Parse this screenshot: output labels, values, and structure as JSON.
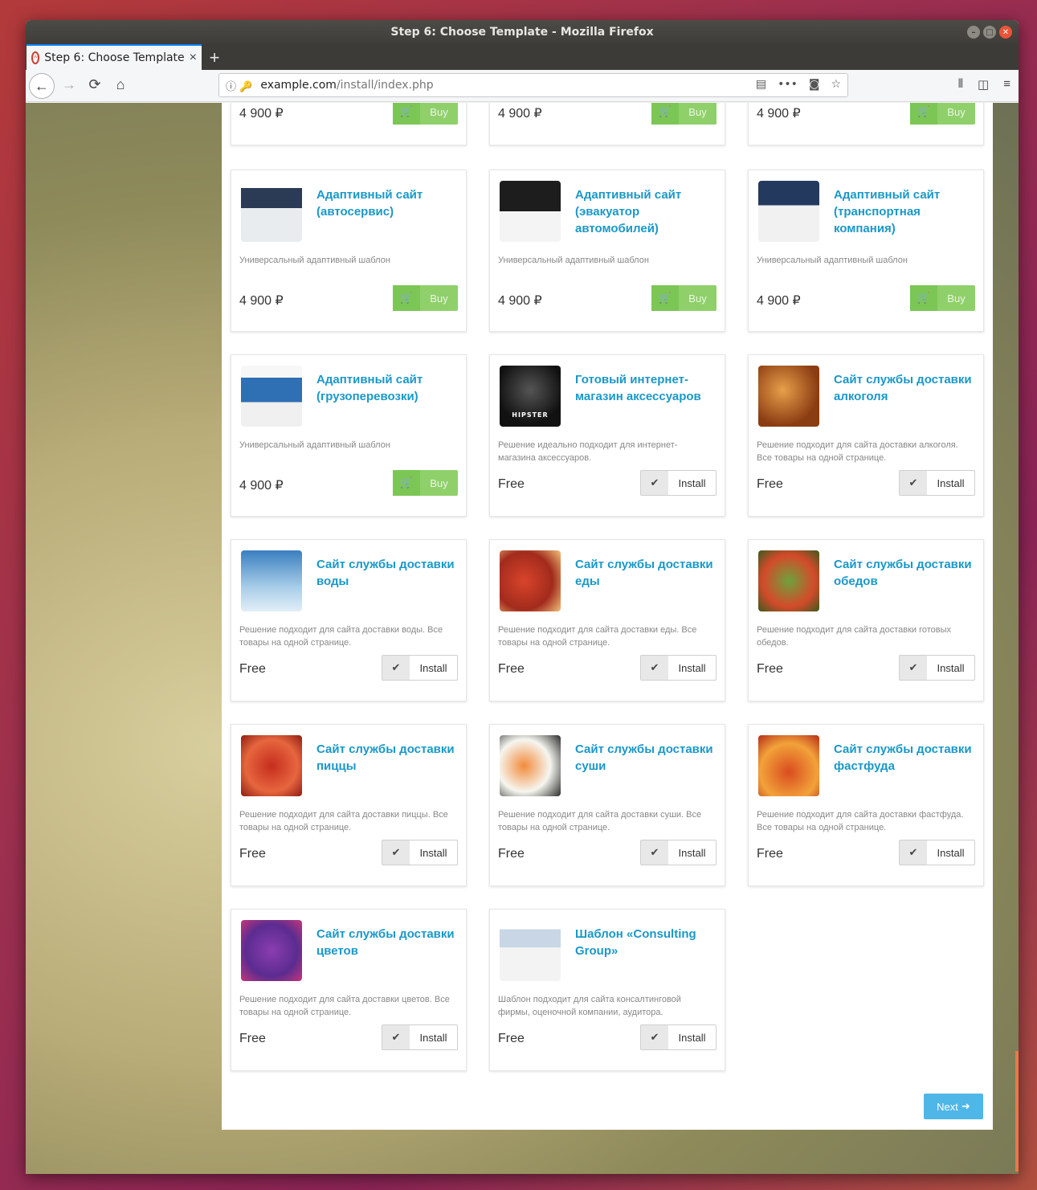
{
  "window": {
    "title": "Step 6: Choose Template - Mozilla Firefox"
  },
  "tab": {
    "title": "Step 6: Choose Template",
    "close": "×",
    "new_tab": "+"
  },
  "url": {
    "domain": "example.com",
    "path": "/install/index.php"
  },
  "icons": {
    "back": "←",
    "forward": "→",
    "reload": "⟳",
    "home": "⌂",
    "menu": "≡",
    "more": "•••",
    "cart": "🛒",
    "check": "✔",
    "next_arrow": "➜"
  },
  "colors": {
    "title_blue": "#1a98c8",
    "buy_green": "#8fd06b",
    "next_blue": "#4fb6e8"
  },
  "top_row": [
    {
      "price": "4 900 ₽",
      "button": "Buy"
    },
    {
      "price": "4 900 ₽",
      "button": "Buy"
    },
    {
      "price": "4 900 ₽",
      "button": "Buy"
    }
  ],
  "cards": [
    {
      "title": "Адаптивный сайт (автосервис)",
      "desc": "Универсальный адаптивный шаблон",
      "price": "4 900 ₽",
      "button": "Buy",
      "thumb": "autoservice"
    },
    {
      "title": "Адаптивный сайт (эвакуатор автомобилей)",
      "desc": "Универсальный адаптивный шаблон",
      "price": "4 900 ₽",
      "button": "Buy",
      "thumb": "evacuator"
    },
    {
      "title": "Адаптивный сайт (транспортная компания)",
      "desc": "Универсальный адаптивный шаблон",
      "price": "4 900 ₽",
      "button": "Buy",
      "thumb": "transport"
    },
    {
      "title": "Адаптивный сайт (грузоперевозки)",
      "desc": "Универсальный адаптивный шаблон",
      "price": "4 900 ₽",
      "button": "Buy",
      "thumb": "cargo"
    },
    {
      "title": "Готовый интернет-магазин аксессуаров",
      "desc": "Решение идеально подходит для интернет-магазина аксессуаров.",
      "price": "Free",
      "button": "Install",
      "thumb": "hipster",
      "thumb_text": "HIPSTER"
    },
    {
      "title": "Сайт службы доставки алкоголя",
      "desc": "Решение подходит для сайта доставки алкоголя. Все товары на одной странице.",
      "price": "Free",
      "button": "Install",
      "thumb": "alcohol"
    },
    {
      "title": "Сайт службы доставки воды",
      "desc": "Решение подходит для сайта доставки воды. Все товары на одной странице.",
      "price": "Free",
      "button": "Install",
      "thumb": "water"
    },
    {
      "title": "Сайт службы доставки еды",
      "desc": "Решение подходит для сайта доставки еды. Все товары на одной странице.",
      "price": "Free",
      "button": "Install",
      "thumb": "food"
    },
    {
      "title": "Сайт службы доставки обедов",
      "desc": "Решение подходит для сайта доставки готовых обедов.",
      "price": "Free",
      "button": "Install",
      "thumb": "lunch"
    },
    {
      "title": "Сайт службы доставки пиццы",
      "desc": "Решение подходит для сайта доставки пиццы. Все товары на одной странице.",
      "price": "Free",
      "button": "Install",
      "thumb": "pizza"
    },
    {
      "title": "Сайт службы доставки суши",
      "desc": "Решение подходит для сайта доставки суши. Все товары на одной странице.",
      "price": "Free",
      "button": "Install",
      "thumb": "sushi"
    },
    {
      "title": "Сайт службы доставки фастфуда",
      "desc": "Решение подходит для сайта доставки фастфуда. Все товары на одной странице.",
      "price": "Free",
      "button": "Install",
      "thumb": "fastfood"
    },
    {
      "title": "Сайт службы доставки цветов",
      "desc": "Решение подходит для сайта доставки цветов. Все товары на одной странице.",
      "price": "Free",
      "button": "Install",
      "thumb": "flowers"
    },
    {
      "title": "Шаблон «Consulting Group»",
      "desc": "Шаблон подходит для сайта консалтинговой фирмы, оценочной компании, аудитора.",
      "price": "Free",
      "button": "Install",
      "thumb": "consulting"
    }
  ],
  "next_button": "Next"
}
